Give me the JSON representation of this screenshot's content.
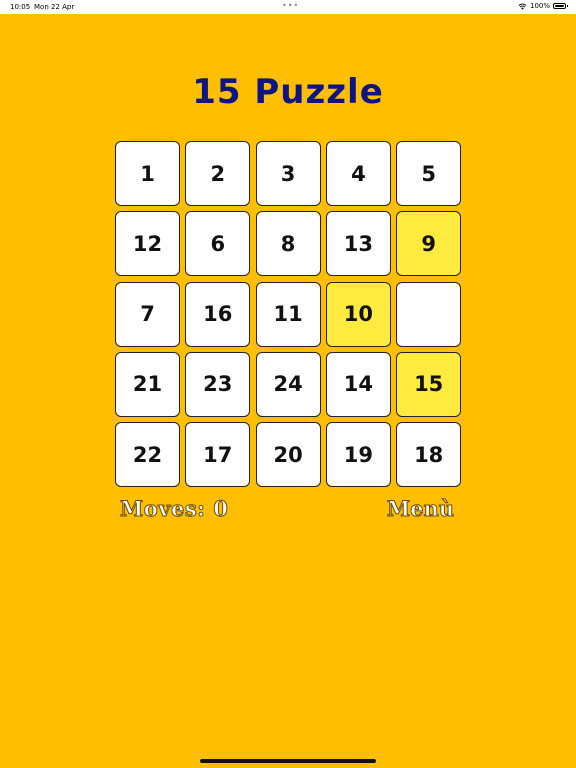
{
  "status_bar": {
    "time": "10:05",
    "date": "Mon 22 Apr",
    "dots": "•••",
    "battery": "100%",
    "wifi_icon": "wifi-icon",
    "battery_icon": "battery-icon"
  },
  "game": {
    "title": "15 Puzzle",
    "moves_label": "Moves: 0",
    "menu_label": "Menù",
    "tiles": [
      [
        "1",
        "2",
        "3",
        "4",
        "5"
      ],
      [
        "12",
        "6",
        "8",
        "13",
        "9"
      ],
      [
        "7",
        "16",
        "11",
        "10",
        ""
      ],
      [
        "21",
        "23",
        "24",
        "14",
        "15"
      ],
      [
        "22",
        "17",
        "20",
        "19",
        "18"
      ]
    ],
    "highlighted_tiles": [
      "9",
      "10",
      "15"
    ]
  },
  "colors": {
    "background": "#FFBE00",
    "title": "#0E1483",
    "tile": "#FFFFFF",
    "tile_highlight": "#FFEA3F"
  }
}
